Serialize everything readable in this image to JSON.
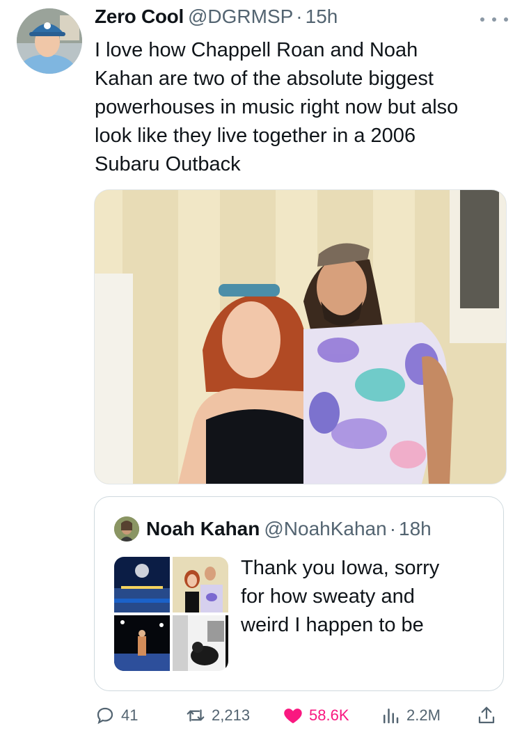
{
  "tweet": {
    "author_name": "Zero Cool",
    "author_handle": "@DGRMSP",
    "separator": "·",
    "time": "15h",
    "text": "I love how Chappell Roan and Noah\nKahan are two of the absolute biggest\npowerhouses in music right now but also\nlook like they live together in a 2006\nSubaru Outback",
    "media_icon": "photo"
  },
  "quote": {
    "author_name": "Noah Kahan",
    "author_handle": "@NoahKahan",
    "separator": "·",
    "time": "18h",
    "text": "Thank you Iowa, sorry\nfor how sweaty and\nweird I happen to be",
    "image_count": 4
  },
  "actions": {
    "replies": "41",
    "retweets": "2,213",
    "likes": "58.6K",
    "views": "2.2M"
  },
  "colors": {
    "like_active": "#f91880",
    "muted": "#536471",
    "text": "#0f1419",
    "border": "#cfd9de"
  }
}
